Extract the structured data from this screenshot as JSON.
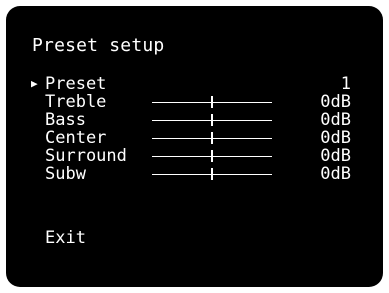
{
  "screen": {
    "title": "Preset setup",
    "background": "#000000",
    "text_color": "#ffffff"
  },
  "menu": {
    "cursor_symbol": "▶",
    "selected_item": "Preset",
    "items": [
      {
        "label": "Preset",
        "value": "1",
        "has_slider": false
      },
      {
        "label": "Treble",
        "value": "0dB",
        "has_slider": true,
        "level": 0.5
      },
      {
        "label": "Bass",
        "value": "0dB",
        "has_slider": true,
        "level": 0.5
      },
      {
        "label": "Center",
        "value": "0dB",
        "has_slider": true,
        "level": 0.5
      },
      {
        "label": "Surround",
        "value": "0dB",
        "has_slider": true,
        "level": 0.5
      },
      {
        "label": "Subw",
        "value": "0dB",
        "has_slider": true,
        "level": 0.5
      }
    ],
    "exit_label": "Exit"
  }
}
